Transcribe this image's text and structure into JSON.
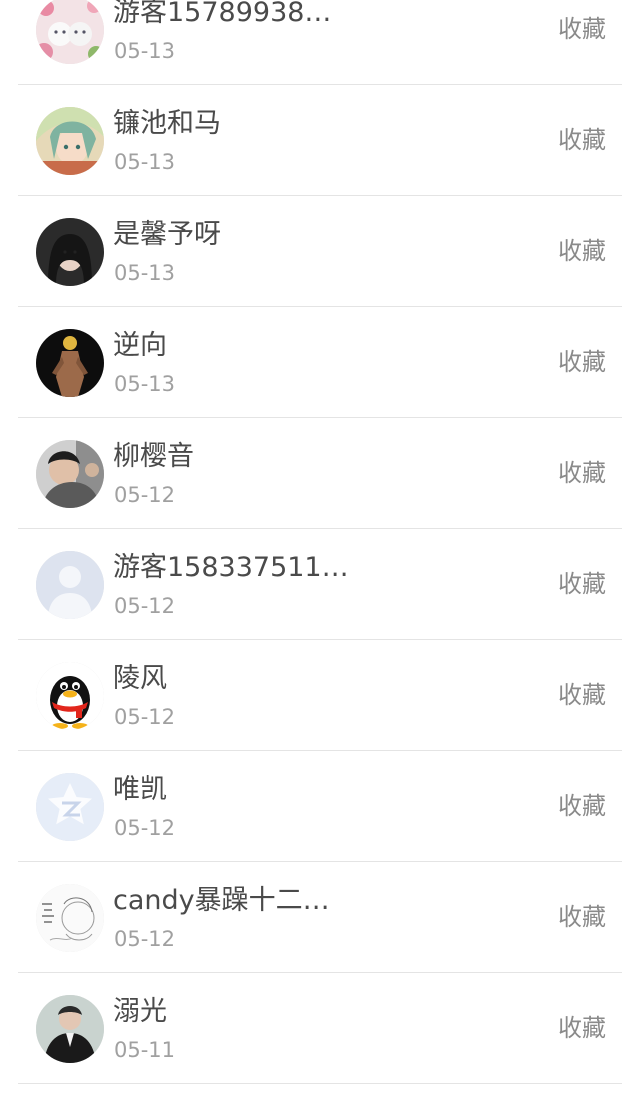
{
  "entries": [
    {
      "name": "游客15789938…",
      "date": "05-13",
      "action": "收藏",
      "avatar": "flowers-kittens"
    },
    {
      "name": "镰池和马",
      "date": "05-13",
      "action": "收藏",
      "avatar": "anime-girl"
    },
    {
      "name": "是馨予呀",
      "date": "05-13",
      "action": "收藏",
      "avatar": "girl-dark-hair"
    },
    {
      "name": "逆向",
      "date": "05-13",
      "action": "收藏",
      "avatar": "figure-dark"
    },
    {
      "name": "柳樱音",
      "date": "05-12",
      "action": "收藏",
      "avatar": "man-photo"
    },
    {
      "name": "游客158337511…",
      "date": "05-12",
      "action": "收藏",
      "avatar": "default-person"
    },
    {
      "name": "陵风",
      "date": "05-12",
      "action": "收藏",
      "avatar": "qq-penguin"
    },
    {
      "name": "唯凯",
      "date": "05-12",
      "action": "收藏",
      "avatar": "qzone-star"
    },
    {
      "name": "candy暴躁十二…",
      "date": "05-12",
      "action": "收藏",
      "avatar": "sketch-art"
    },
    {
      "name": "溺光",
      "date": "05-11",
      "action": "收藏",
      "avatar": "man-suit"
    }
  ]
}
